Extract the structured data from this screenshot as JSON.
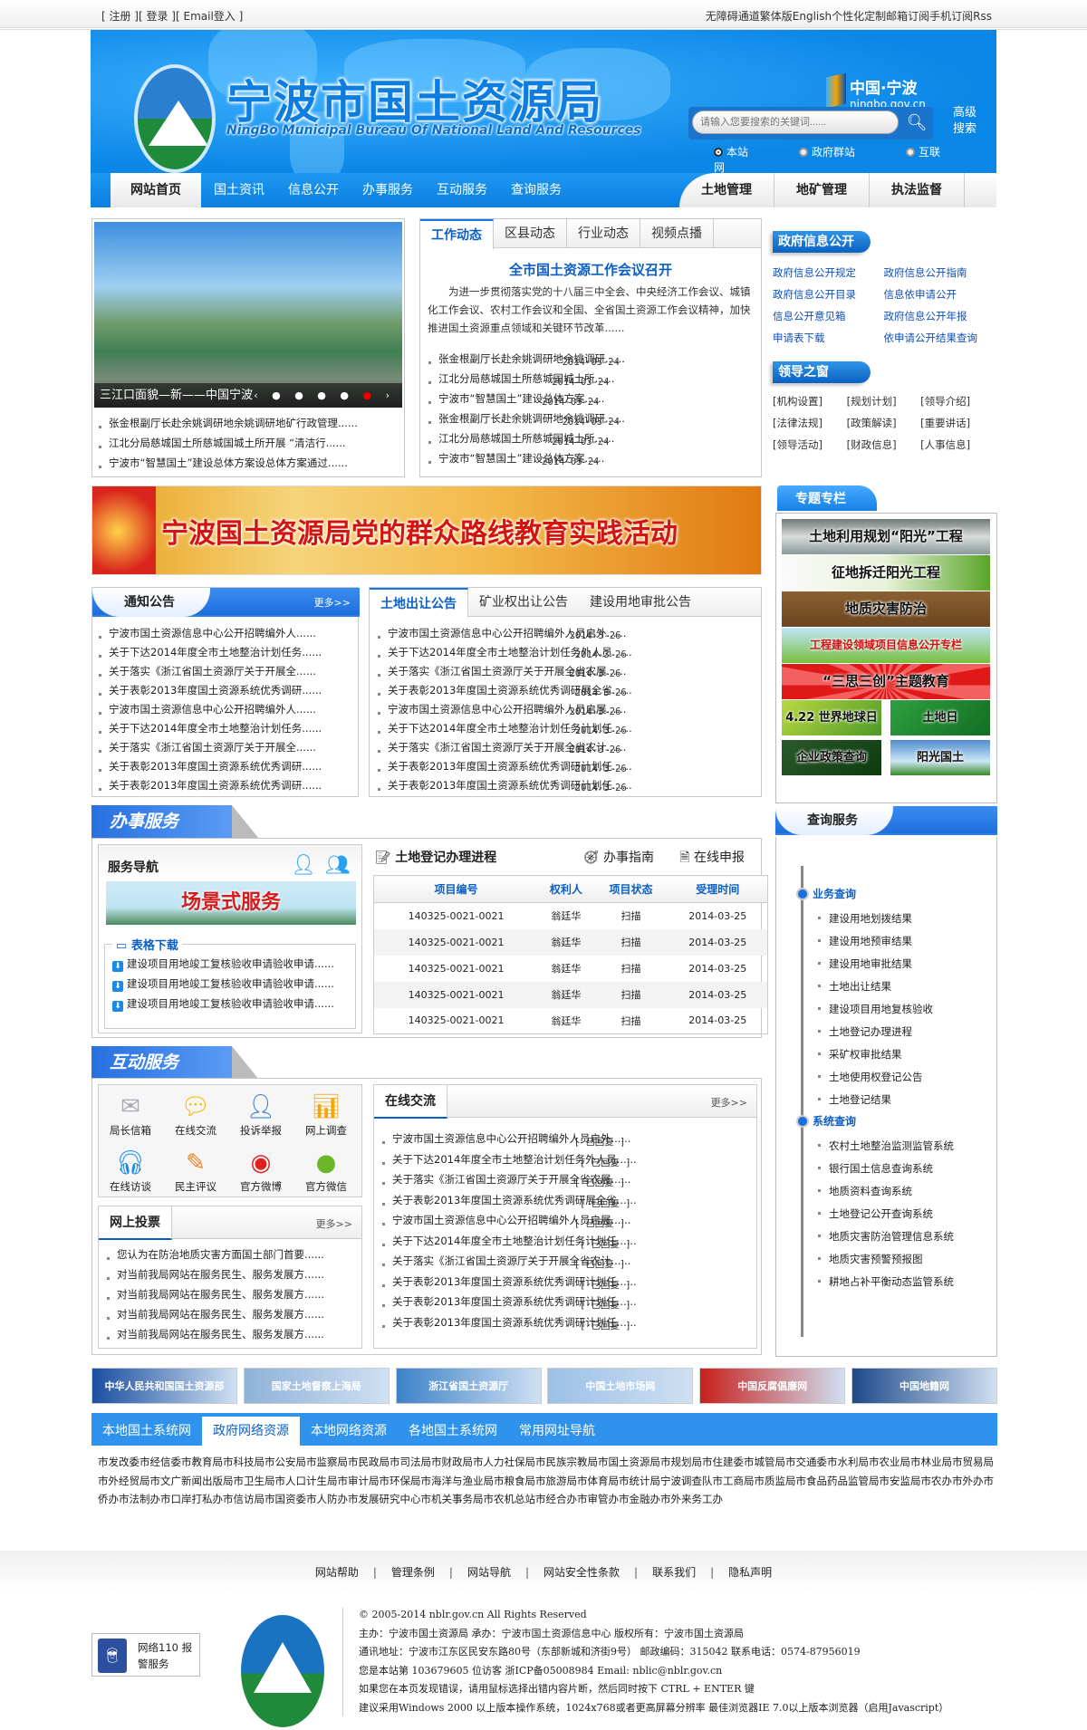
{
  "topbar": {
    "left": [
      "[ 注册 ]",
      "[ 登录 ]",
      "[ Email登入 ]"
    ],
    "right": [
      "无障碍通道",
      "繁体版",
      "English",
      "个性化定制",
      "邮箱订阅",
      "手机订阅",
      "Rss"
    ]
  },
  "header": {
    "title": "宁波市国土资源局",
    "subtitle": "NingBo Municipal Bureau Of National Land And Resources",
    "portal": "中国·宁波",
    "portal_url": "ningbo.gov.cn",
    "search_placeholder": "请输入您要搜索的关键词......",
    "advanced_search": "高级搜索",
    "scopes": [
      {
        "label": "本站",
        "selected": true
      },
      {
        "label": "政府群站",
        "selected": false
      },
      {
        "label": "互联网",
        "selected": false
      }
    ]
  },
  "nav": {
    "items": [
      "网站首页",
      "国土资讯",
      "信息公开",
      "办事服务",
      "互动服务",
      "查询服务"
    ],
    "right": [
      "土地管理",
      "地矿管理",
      "执法监督"
    ]
  },
  "slideshow": {
    "caption": "三江口面貌—新——中国宁波",
    "items": [
      "张金根副厅长赴余姚调研地余姚调研地矿行政管理......",
      "江北分局慈城国土所慈城国城土所开展 “清洁行......",
      "宁波市“智慧国土”建设总体方案设总体方案通过......"
    ]
  },
  "news": {
    "tabs": [
      "工作动态",
      "区县动态",
      "行业动态",
      "视频点播"
    ],
    "headline": "全市国土资源工作会议召开",
    "summary": "为进一步贯彻落实党的十八届三中全会、中央经济工作会议、城镇化工作会议、农村工作会议和全国、全省国土资源工作会议精神，加快推进国土资源重点领域和关键环节改革......",
    "items": [
      {
        "title": "张金根副厅长赴余姚调研地余姚调研......",
        "date": "2014-03-24"
      },
      {
        "title": "江北分局慈城国土所慈城国城土所......",
        "date": "2014-03-24"
      },
      {
        "title": "宁波市“智慧国土”建设总体方案......",
        "date": "2014-03-24"
      },
      {
        "title": "张金根副厅长赴余姚调研地余姚调研......",
        "date": "2014-03-24"
      },
      {
        "title": "江北分局慈城国土所慈城国城土所......",
        "date": "2014-03-24"
      },
      {
        "title": "宁波市“智慧国土”建设总体方案......",
        "date": "2014-03-24"
      }
    ]
  },
  "gov_info": {
    "title": "政府信息公开",
    "links": [
      "政府信息公开规定",
      "政府信息公开指南",
      "政府信息公开目录",
      "信息依申请公开",
      "信息公开意见箱",
      "政府信息公开年报",
      "申请表下载",
      "依申请公开结果查询"
    ]
  },
  "leaders": {
    "title": "领导之窗",
    "links": [
      "[机构设置]",
      "[规划计划]",
      "[领导介绍]",
      "[法律法规]",
      "[政策解读]",
      "[重要讲话]",
      "[领导活动]",
      "[财政信息]",
      "[人事信息]"
    ]
  },
  "banner": {
    "text": "宁波国土资源局党的群众路线教育实践活动"
  },
  "special": {
    "title": "专题专栏",
    "items": [
      "土地利用规划“阳光”工程",
      "征地拆迁阳光工程",
      "地质灾害防治",
      "工程建设领域项目信息公开专栏",
      "“三思三创”主题教育",
      "4.22 世界地球日",
      "土地日",
      "企业政策查询",
      "阳光国土"
    ]
  },
  "notice": {
    "title": "通知公告",
    "more": "更多>>",
    "items": [
      "宁波市国土资源信息中心公开招聘编外人......",
      "关于下达2014年度全市土地整治计划任务......",
      "关于落实《浙江省国土资源厅关于开展全......",
      "关于表彰2013年度国土资源系统优秀调研......",
      "宁波市国土资源信息中心公开招聘编外人......",
      "关于下达2014年度全市土地整治计划任务......",
      "关于落实《浙江省国土资源厅关于开展全......",
      "关于表彰2013年度国土资源系统优秀调研......",
      "关于表彰2013年度国土资源系统优秀调研......"
    ]
  },
  "land": {
    "tabs": [
      "土地出让公告",
      "矿业权出让公告",
      "建设用地审批公告"
    ],
    "items": [
      {
        "title": "宁波市国土资源信息中心公开招聘编外人员启外......",
        "date": "2014-3-26"
      },
      {
        "title": "关于下达2014年度全市土地整治计划任务外人员......",
        "date": "2014-3-26"
      },
      {
        "title": "关于落实《浙江省国土资源厅关于开展全省农展......",
        "date": "2014-3-26"
      },
      {
        "title": "关于表彰2013年度国土资源系统优秀调研展全省......",
        "date": "2014-3-26"
      },
      {
        "title": "宁波市国土资源信息中心公开招聘编外人员启展......",
        "date": "2014-3-26"
      },
      {
        "title": "关于下达2014年度全市土地整治计划任务计划任......",
        "date": "2014-3-26"
      },
      {
        "title": "关于落实《浙江省国土资源厅关于开展全省农计......",
        "date": "2014-3-26"
      },
      {
        "title": "关于表彰2013年度国土资源系统优秀调研计划任......",
        "date": "2014-3-26"
      },
      {
        "title": "关于表彰2013年度国土资源系统优秀调研计划任......",
        "date": "2014-3-26"
      }
    ]
  },
  "services": {
    "title": "办事服务",
    "nav_title": "服务导航",
    "scene": "场景式服务",
    "forms_title": "表格下载",
    "forms": [
      "建设项目用地竣工复核验收申请验收申请......",
      "建设项目用地竣工复核验收申请验收申请......",
      "建设项目用地竣工复核验收申请验收申请......"
    ],
    "registration": {
      "title": "土地登记办理进程",
      "guide": "办事指南",
      "online": "在线申报",
      "columns": [
        "项目编号",
        "权利人",
        "项目状态",
        "受理时间"
      ],
      "rows": [
        [
          "140325-0021-0021",
          "翁廷华",
          "扫描",
          "2014-03-25"
        ],
        [
          "140325-0021-0021",
          "翁廷华",
          "扫描",
          "2014-03-25"
        ],
        [
          "140325-0021-0021",
          "翁廷华",
          "扫描",
          "2014-03-25"
        ],
        [
          "140325-0021-0021",
          "翁廷华",
          "扫描",
          "2014-03-25"
        ],
        [
          "140325-0021-0021",
          "翁廷华",
          "扫描",
          "2014-03-25"
        ]
      ]
    }
  },
  "query": {
    "title": "查询服务",
    "groups": [
      {
        "label": "业务查询",
        "items": [
          "建设用地划拨结果",
          "建设用地预审结果",
          "建设用地审批结果",
          "土地出让结果",
          "建设项目用地复核验收",
          "土地登记办理进程",
          "采矿权审批结果",
          "土地使用权登记公告",
          "土地登记结果"
        ]
      },
      {
        "label": "系统查询",
        "items": [
          "农村土地整治监测监管系统",
          "银行国土信息查询系统",
          "地质资料查询系统",
          "土地登记公开查询系统",
          "地质灾害防治管理信息系统",
          "地质灾害预警预报图",
          "耕地占补平衡动态监管系统"
        ]
      }
    ]
  },
  "interact": {
    "title": "互动服务",
    "icons": [
      {
        "label": "局长信箱",
        "glyph": "✉",
        "color": "#aab"
      },
      {
        "label": "在线交流",
        "glyph": "💬",
        "color": "#f5b800"
      },
      {
        "label": "投诉举报",
        "glyph": "👤",
        "color": "#2a7ad0"
      },
      {
        "label": "网上调查",
        "glyph": "📊",
        "color": "#f5a400"
      },
      {
        "label": "在线访谈",
        "glyph": "🎧",
        "color": "#1a8ae8"
      },
      {
        "label": "民主评议",
        "glyph": "✎",
        "color": "#f08020"
      },
      {
        "label": "官方微博",
        "glyph": "◉",
        "color": "#e02020"
      },
      {
        "label": "官方微信",
        "glyph": "●",
        "color": "#6ab82a"
      }
    ],
    "vote": {
      "title": "网上投票",
      "more": "更多>>",
      "items": [
        "您认为在防治地质灾害方面国土部门首要......",
        "对当前我局网站在服务民生、服务发展方......",
        "对当前我局网站在服务民生、服务发展方......",
        "对当前我局网站在服务民生、服务发展方......",
        "对当前我局网站在服务民生、服务发展方......"
      ]
    },
    "chat": {
      "title": "在线交流",
      "more": "更多>>",
      "status": "[ 已回复 ]",
      "items": [
        "宁波市国土资源信息中心公开招聘编外人员启外......",
        "关于下达2014年度全市土地整治计划任务外人员......",
        "关于落实《浙江省国土资源厅关于开展全省农展......",
        "关于表彰2013年度国土资源系统优秀调研展全省......",
        "宁波市国土资源信息中心公开招聘编外人员启展......",
        "关于下达2014年度全市土地整治计划任务计划任......",
        "关于落实《浙江省国土资源厅关于开展全省农计......",
        "关于表彰2013年度国土资源系统优秀调研计划任......",
        "关于表彰2013年度国土资源系统优秀调研计划任......",
        "关于表彰2013年度国土资源系统优秀调研计划任......"
      ]
    }
  },
  "logos": [
    {
      "label": "中华人民共和国国土资源部",
      "bg": "#1a4fa0"
    },
    {
      "label": "国家土地督察上海局",
      "bg": "#8fb2d8"
    },
    {
      "label": "浙江省国土资源厅",
      "bg": "#3d82c8"
    },
    {
      "label": "中国土地市场网",
      "bg": "#9cc0e6"
    },
    {
      "label": "中国反腐倡廉网",
      "bg": "#c8201c"
    },
    {
      "label": "中国地籍网",
      "bg": "#1d4a8a"
    }
  ],
  "links": {
    "tabs": [
      "本地国土系统网",
      "政府网络资源",
      "本地网络资源",
      "各地国土系统网",
      "常用网址导航"
    ],
    "items": [
      "市发改委",
      "市经信委",
      "市教育局",
      "市科技局",
      "市公安局",
      "市监察局",
      "市民政局",
      "市司法局",
      "市财政局",
      "市人力社保局",
      "市民族宗教局",
      "市国土资源局",
      "市规划局",
      "市住建委",
      "市城管局",
      "市交通委",
      "市水利局",
      "市农业局",
      "市林业局",
      "市贸易局",
      "市外经贸局",
      "市文广新闻出版局",
      "市卫生局",
      "市人口计生局",
      "市审计局",
      "市环保局",
      "市海洋与渔业局",
      "市粮食局",
      "市旅游局",
      "市体育局",
      "市统计局宁波调查队",
      "市工商局",
      "市质监局",
      "市食品药品监管局",
      "市安监局",
      "市农办",
      "市外办",
      "市侨办",
      "市法制办",
      "市口岸打私办",
      "市信访局",
      "市国资委",
      "市人防办",
      "市发展研究中心",
      "市机关事务局",
      "市农机总站",
      "市经合办",
      "市审管办",
      "市金融办",
      "市外来务工办"
    ]
  },
  "footer": {
    "nav": [
      "网站帮助",
      "管理条例",
      "网站导航",
      "网站安全性条款",
      "联系我们",
      "隐私声明"
    ],
    "police": "网络110 报警服务",
    "info": [
      "© 2005-2014 nblr.gov.cn All Rights Reserved",
      "主办：宁波市国土资源局 承办：宁波市国土资源信息中心 版权所有：宁波市国土资源局",
      "通讯地址：宁波市江东区民安东路80号（东部新城和济街9号） 邮政编码：315042 联系电话：0574-87956019",
      "您是本站第 103679605 位访客 浙ICP备05008984 Email: nblic@nblr.gov.cn",
      "如果您在本页发现错误，请用鼠标选择出错内容片断，然后同时按下 CTRL + ENTER 键",
      "建议采用Windows 2000 以上版本操作系统，1024x768或者更高屏幕分辨率 最佳浏览器IE 7.0以上版本浏览器（启用Javascript）"
    ]
  }
}
